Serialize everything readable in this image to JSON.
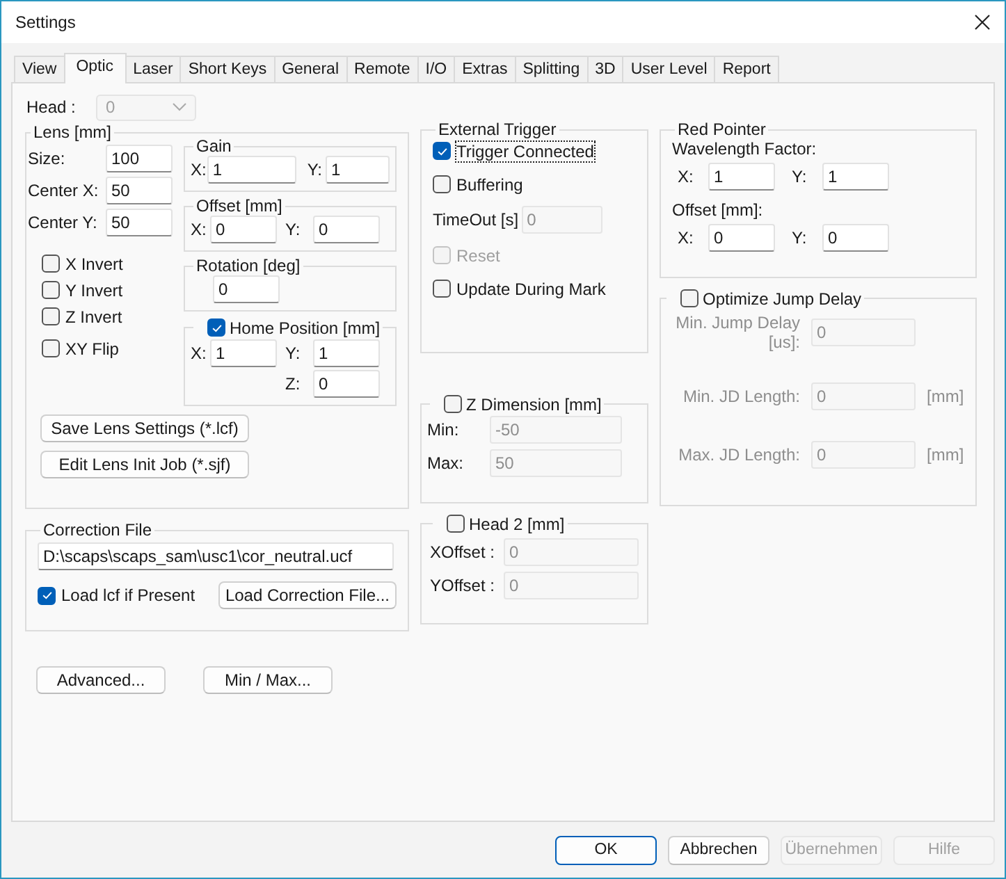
{
  "window": {
    "title": "Settings"
  },
  "tabs": [
    {
      "label": "View",
      "selected": false
    },
    {
      "label": "Optic",
      "selected": true
    },
    {
      "label": "Laser",
      "selected": false
    },
    {
      "label": "Short Keys",
      "selected": false
    },
    {
      "label": "General",
      "selected": false
    },
    {
      "label": "Remote",
      "selected": false
    },
    {
      "label": "I/O",
      "selected": false
    },
    {
      "label": "Extras",
      "selected": false
    },
    {
      "label": "Splitting",
      "selected": false
    },
    {
      "label": "3D",
      "selected": false
    },
    {
      "label": "User Level",
      "selected": false
    },
    {
      "label": "Report",
      "selected": false
    }
  ],
  "head": {
    "label": "Head :",
    "value": "0",
    "disabled": true
  },
  "lens": {
    "title": "Lens  [mm]",
    "fields": [
      {
        "label": "Size:",
        "value": "100"
      },
      {
        "label": "Center X:",
        "value": "50"
      },
      {
        "label": "Center Y:",
        "value": "50"
      }
    ],
    "checkboxes": [
      {
        "label": "X Invert",
        "checked": false
      },
      {
        "label": "Y Invert",
        "checked": false
      },
      {
        "label": "Z Invert",
        "checked": false
      },
      {
        "label": "XY Flip",
        "checked": false
      }
    ],
    "gain": {
      "title": "Gain",
      "fields": [
        {
          "label": "X:",
          "value": "1"
        },
        {
          "label": "Y:",
          "value": "1"
        }
      ]
    },
    "offset": {
      "title": "Offset [mm]",
      "fields": [
        {
          "label": "X:",
          "value": "0"
        },
        {
          "label": "Y:",
          "value": "0"
        }
      ]
    },
    "rotation": {
      "title": "Rotation [deg]",
      "value": "0"
    },
    "home_position": {
      "label": "Home Position [mm]",
      "checked": true,
      "fields": [
        {
          "label": "X:",
          "value": "1"
        },
        {
          "label": "Y:",
          "value": "1"
        },
        {
          "label": "Z:",
          "value": "0"
        }
      ]
    },
    "buttons": [
      "Save Lens Settings (*.lcf)",
      "Edit Lens Init Job (*.sjf)"
    ]
  },
  "correction_file": {
    "title": "Correction File",
    "path": "D:\\scaps\\scaps_sam\\usc1\\cor_neutral.ucf",
    "load_lcf": {
      "label": "Load lcf if Present",
      "checked": true
    },
    "button": "Load Correction File..."
  },
  "extra_buttons": [
    "Advanced...",
    "Min / Max..."
  ],
  "external_trigger": {
    "title": "External Trigger",
    "items": [
      {
        "kind": "checkbox",
        "label": "Trigger Connected",
        "checked": true,
        "disabled": false,
        "focused": true
      },
      {
        "kind": "checkbox",
        "label": "Buffering",
        "checked": false,
        "disabled": false,
        "focused": false
      },
      {
        "kind": "field",
        "label": "TimeOut [s]",
        "value": "0",
        "disabled": true
      },
      {
        "kind": "checkbox",
        "label": "Reset",
        "checked": false,
        "disabled": true,
        "focused": false
      },
      {
        "kind": "checkbox",
        "label": "Update During Mark",
        "checked": false,
        "disabled": false,
        "focused": false
      }
    ]
  },
  "z_dimension": {
    "label": "Z Dimension [mm]",
    "checked": false,
    "fields": [
      {
        "label": "Min:",
        "value": "-50"
      },
      {
        "label": "Max:",
        "value": "50"
      }
    ]
  },
  "head_2": {
    "label": "Head 2 [mm]",
    "checked": false,
    "fields": [
      {
        "label": "XOffset :",
        "value": "0"
      },
      {
        "label": "YOffset :",
        "value": "0"
      }
    ]
  },
  "red_pointer": {
    "title": "Red Pointer",
    "wavelength_label": "Wavelength Factor:",
    "wavelength_fields": [
      {
        "label": "X:",
        "value": "1"
      },
      {
        "label": "Y:",
        "value": "1"
      }
    ],
    "offset_label": "Offset [mm]:",
    "offset_fields": [
      {
        "label": "X:",
        "value": "0"
      },
      {
        "label": "Y:",
        "value": "0"
      }
    ]
  },
  "optimize_jump_delay": {
    "label": "Optimize Jump Delay",
    "checked": false,
    "rows": [
      {
        "label": "Min. Jump Delay [us]:",
        "value": "0"
      },
      {
        "label": "Min. JD Length:",
        "value": "0",
        "unit": "[mm]"
      },
      {
        "label": "Max. JD Length:",
        "value": "0",
        "unit": "[mm]"
      }
    ]
  },
  "footer_buttons": [
    {
      "label": "OK",
      "default": true,
      "disabled": false
    },
    {
      "label": "Abbrechen",
      "default": false,
      "disabled": false
    },
    {
      "label": "Übernehmen",
      "default": false,
      "disabled": true
    },
    {
      "label": "Hilfe",
      "default": false,
      "disabled": true
    }
  ]
}
